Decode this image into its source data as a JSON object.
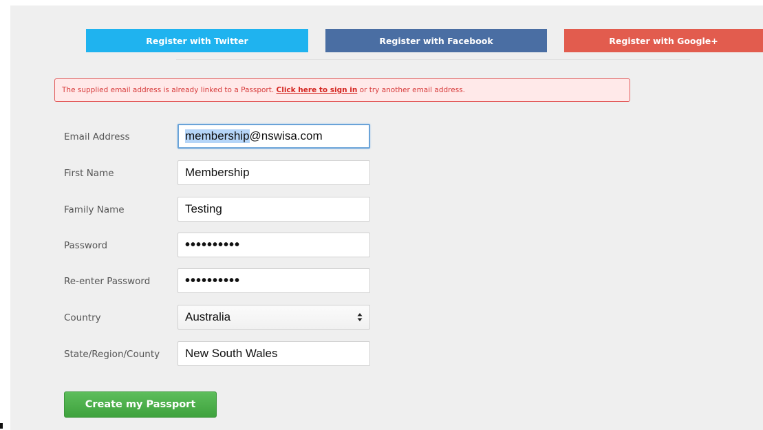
{
  "social": {
    "twitter_label": "Register with Twitter",
    "facebook_label": "Register with Facebook",
    "google_label": "Register with Google+"
  },
  "alert": {
    "prefix": "The supplied email address is already linked to a Passport. ",
    "link": "Click here to sign in",
    "suffix": " or try another email address."
  },
  "form": {
    "email": {
      "label": "Email Address",
      "value_selected": "membership",
      "value_rest": "@nswisa.com"
    },
    "first_name": {
      "label": "First Name",
      "value": "Membership"
    },
    "family_name": {
      "label": "Family Name",
      "value": "Testing"
    },
    "password": {
      "label": "Password",
      "value": "••••••••••"
    },
    "reenter_password": {
      "label": "Re-enter Password",
      "value": "••••••••••"
    },
    "country": {
      "label": "Country",
      "value": "Australia"
    },
    "state": {
      "label": "State/Region/County",
      "value": "New South Wales"
    }
  },
  "submit_label": "Create my Passport",
  "icons": {
    "select": "up-down-arrows-icon"
  },
  "colors": {
    "twitter": "#1fb3ef",
    "facebook": "#4a6ea3",
    "google": "#e25c4e",
    "alert_border": "#e35a5a",
    "submit": "#4cae4a"
  }
}
